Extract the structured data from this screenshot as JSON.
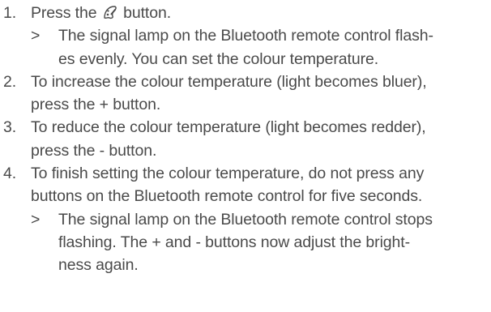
{
  "result_marker": ">",
  "steps": [
    {
      "number": "1.",
      "text_before_icon": "Press the ",
      "icon": "colour-temperature-icon",
      "text_after_icon": " button.",
      "result_lines": [
        "The signal lamp on the Bluetooth remote control flash-",
        "es evenly. You can set the colour temperature."
      ]
    },
    {
      "number": "2.",
      "lines": [
        "To increase the colour temperature (light becomes bluer),",
        "press the + button."
      ]
    },
    {
      "number": "3.",
      "lines": [
        "To reduce the colour temperature (light becomes redder),",
        "press the - button."
      ]
    },
    {
      "number": "4.",
      "lines": [
        "To finish setting the colour temperature, do not press any",
        "buttons on the Bluetooth remote control for five seconds."
      ],
      "result_lines": [
        "The signal lamp on the Bluetooth remote control stops",
        "flashing. The + and - buttons now adjust the bright-",
        "ness again."
      ]
    }
  ]
}
